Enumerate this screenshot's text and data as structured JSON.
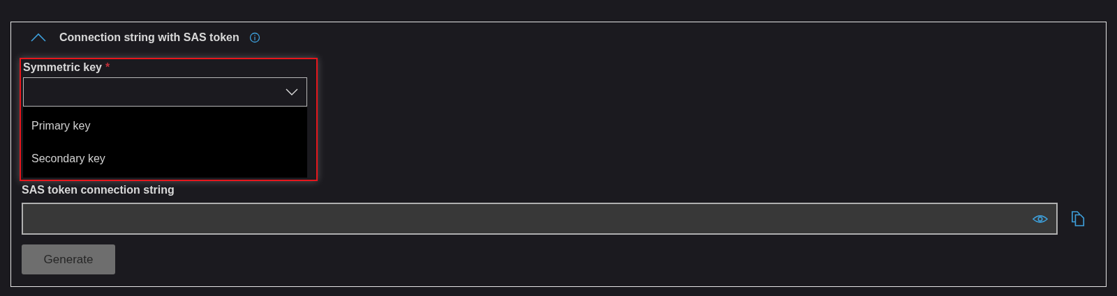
{
  "section": {
    "title": "Connection string with SAS token",
    "expanded": true
  },
  "symmetric_key": {
    "label": "Symmetric key",
    "required_mark": "*",
    "expanded": true,
    "highlighted": true,
    "options": [
      {
        "label": "Primary key",
        "selected": false
      },
      {
        "label": "Secondary key",
        "selected": false
      }
    ]
  },
  "connection_string": {
    "label": "SAS token connection string"
  },
  "generate_button": {
    "label": "Generate",
    "disabled": true
  }
}
